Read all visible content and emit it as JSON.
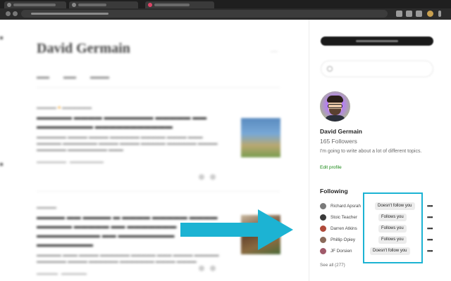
{
  "profile": {
    "name": "David Germain",
    "followers": "165 Followers",
    "bio": "I'm going to write about a lot of different topics.",
    "edit_link": "Edit profile"
  },
  "main": {
    "title": "David Germain",
    "more": "···"
  },
  "following": {
    "title": "Following",
    "items": [
      {
        "name": "Richard Apsrah",
        "status": "Doesn't follow you",
        "avatar_color": "#7a7a7a"
      },
      {
        "name": "Stoic Teacher",
        "status": "Follows you",
        "avatar_color": "#3a3a3a"
      },
      {
        "name": "Darren Atkins",
        "status": "Follows you",
        "avatar_color": "#b04a3a"
      },
      {
        "name": "Phillip Opiey",
        "status": "Follows you",
        "avatar_color": "#8a6a5a"
      },
      {
        "name": "JF Dorsien",
        "status": "Doesn't follow you",
        "avatar_color": "#a05a6a"
      }
    ],
    "more_label": "•••",
    "see_all": "See all (277)"
  },
  "colors": {
    "highlight": "#1cb3d3",
    "arrow": "#1cb3d3",
    "edit_link": "#1a8917"
  },
  "icons": [
    "arrow-right-icon",
    "search-icon",
    "more-icon"
  ]
}
